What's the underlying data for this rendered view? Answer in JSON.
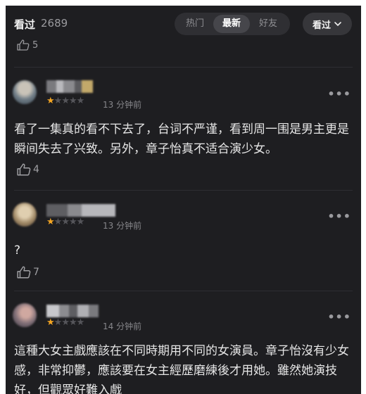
{
  "header": {
    "title": "看过",
    "count": "2689",
    "tabs": [
      {
        "label": "热门",
        "active": false
      },
      {
        "label": "最新",
        "active": true
      },
      {
        "label": "好友",
        "active": false
      }
    ],
    "sort_label": "看过"
  },
  "previous_comment": {
    "likes": "5",
    "like_icon": "thumbs-up-icon"
  },
  "comments": [
    {
      "rating": 1,
      "max_rating": 5,
      "time": "13 分钟前",
      "text": "看了一集真的看不下去了，台词不严谨，看到周一围是男主更是瞬间失去了兴致。另外，章子怡真不适合演少女。",
      "likes": "4",
      "more_icon": "more-dots-icon"
    },
    {
      "rating": 1,
      "max_rating": 5,
      "time": "13 分钟前",
      "text": "?",
      "likes": "7",
      "more_icon": "more-dots-icon"
    },
    {
      "rating": 1,
      "max_rating": 5,
      "time": "14 分钟前",
      "text": "這種大女主戲應該在不同時期用不同的女演員。章子怡沒有少女感，非常抑鬱，應該要在女主經歷磨練後才用她。雖然她演技好，但觀眾好難入戲",
      "likes": "",
      "more_icon": "more-dots-icon"
    }
  ],
  "colors": {
    "background": "#1e1e21",
    "star_on": "#f5a623",
    "star_off": "#55555a"
  }
}
